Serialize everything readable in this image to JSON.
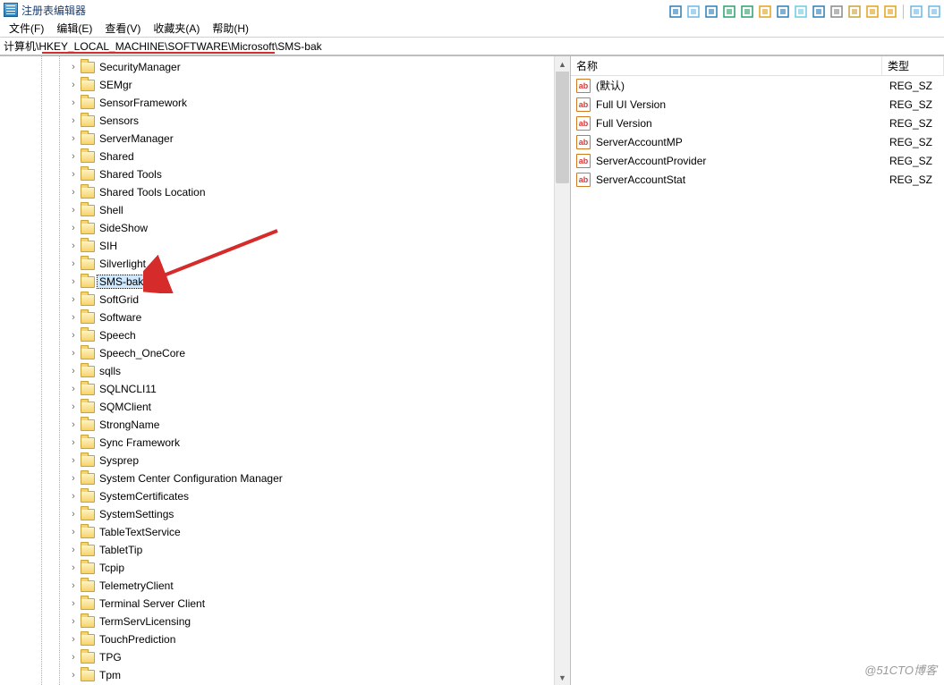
{
  "window": {
    "title": "注册表编辑器"
  },
  "menubar": {
    "items": [
      "文件(F)",
      "编辑(E)",
      "查看(V)",
      "收藏夹(A)",
      "帮助(H)"
    ]
  },
  "address": "计算机\\HKEY_LOCAL_MACHINE\\SOFTWARE\\Microsoft\\SMS-bak",
  "tree": {
    "selected": "SMS-bak",
    "items": [
      "SecurityManager",
      "SEMgr",
      "SensorFramework",
      "Sensors",
      "ServerManager",
      "Shared",
      "Shared Tools",
      "Shared Tools Location",
      "Shell",
      "SideShow",
      "SIH",
      "Silverlight",
      "SMS-bak",
      "SoftGrid",
      "Software",
      "Speech",
      "Speech_OneCore",
      "sqlls",
      "SQLNCLI11",
      "SQMClient",
      "StrongName",
      "Sync Framework",
      "Sysprep",
      "System Center Configuration Manager",
      "SystemCertificates",
      "SystemSettings",
      "TableTextService",
      "TabletTip",
      "Tcpip",
      "TelemetryClient",
      "Terminal Server Client",
      "TermServLicensing",
      "TouchPrediction",
      "TPG",
      "Tpm"
    ]
  },
  "values": {
    "header_name": "名称",
    "header_type": "类型",
    "rows": [
      {
        "name": "(默认)",
        "type": "REG_SZ"
      },
      {
        "name": "Full UI Version",
        "type": "REG_SZ"
      },
      {
        "name": "Full Version",
        "type": "REG_SZ"
      },
      {
        "name": "ServerAccountMP",
        "type": "REG_SZ"
      },
      {
        "name": "ServerAccountProvider",
        "type": "REG_SZ"
      },
      {
        "name": "ServerAccountStat",
        "type": "REG_SZ"
      }
    ]
  },
  "icon_label": "ab",
  "watermark": "@51CTO博客",
  "toolbar_icons": [
    "check-icon",
    "doc1-icon",
    "doc2-icon",
    "export-icon",
    "refresh-icon",
    "warn-icon",
    "attach-icon",
    "phone-icon",
    "doc3-icon",
    "block-icon",
    "copy-icon",
    "lock-icon",
    "home-icon",
    "sep",
    "win1-icon",
    "win2-icon"
  ]
}
